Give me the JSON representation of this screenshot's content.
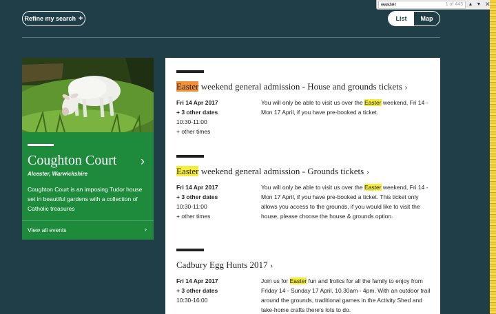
{
  "find_bar": {
    "query": "easter",
    "count": "1 of 443",
    "prev": "▲",
    "next": "▼",
    "close": "✕"
  },
  "controls": {
    "refine_label": "Refine my search",
    "refine_icon": "+",
    "view_list": "List",
    "view_map": "Map"
  },
  "property": {
    "name": "Coughton Court",
    "location": "Alcester, Warwickshire",
    "description": "Coughton Court is an imposing Tudor house set in beautiful gardens with a collection of Catholic treasures",
    "view_all": "View all events",
    "chevron": "›",
    "link_chevron": "›"
  },
  "events": [
    {
      "title_highlight": "Easter",
      "title_rest": " weekend general admission - House and grounds tickets",
      "chevron": "›",
      "date": "Fri 14 Apr 2017",
      "other_dates": "+ 3 other dates",
      "time": "10:30-11:00",
      "other_times": "+ other times",
      "desc_before": "You will only be able to visit us over the ",
      "desc_highlight": "Easter",
      "desc_after": " weekend, Fri 14 - Mon 17 April, if you have pre-booked a ticket."
    },
    {
      "title_highlight": "Easter",
      "title_rest": " weekend general admission - Grounds tickets",
      "chevron": "›",
      "date": "Fri 14 Apr 2017",
      "other_dates": "+ 3 other dates",
      "time": "10:30-11:00",
      "other_times": "+ other times",
      "desc_before": "You will only be able to visit us over the ",
      "desc_highlight": "Easter",
      "desc_after": " weekend, Fri 14 - Mon 17 April, if you have pre-booked a ticket. This ticket only allows you access to the grounds, if you would like to visit the house, please choose the house & grounds option."
    },
    {
      "title_highlight": "",
      "title_rest": "Cadbury Egg Hunts 2017",
      "chevron": "›",
      "date": "Fri 14 Apr 2017",
      "other_dates": "+ 3 other dates",
      "time": "10:30-16:00",
      "other_times": "",
      "desc_before": "Join us for ",
      "desc_highlight": "Easter",
      "desc_after": " fun and frolics for all the family to enjoy from Friday 14 - Sunday 17 April, 10.30am - 4pm. With an outdoor trail around the grounds, traditional games in the Activity Shed and take-home crafts there's lots to do."
    }
  ]
}
